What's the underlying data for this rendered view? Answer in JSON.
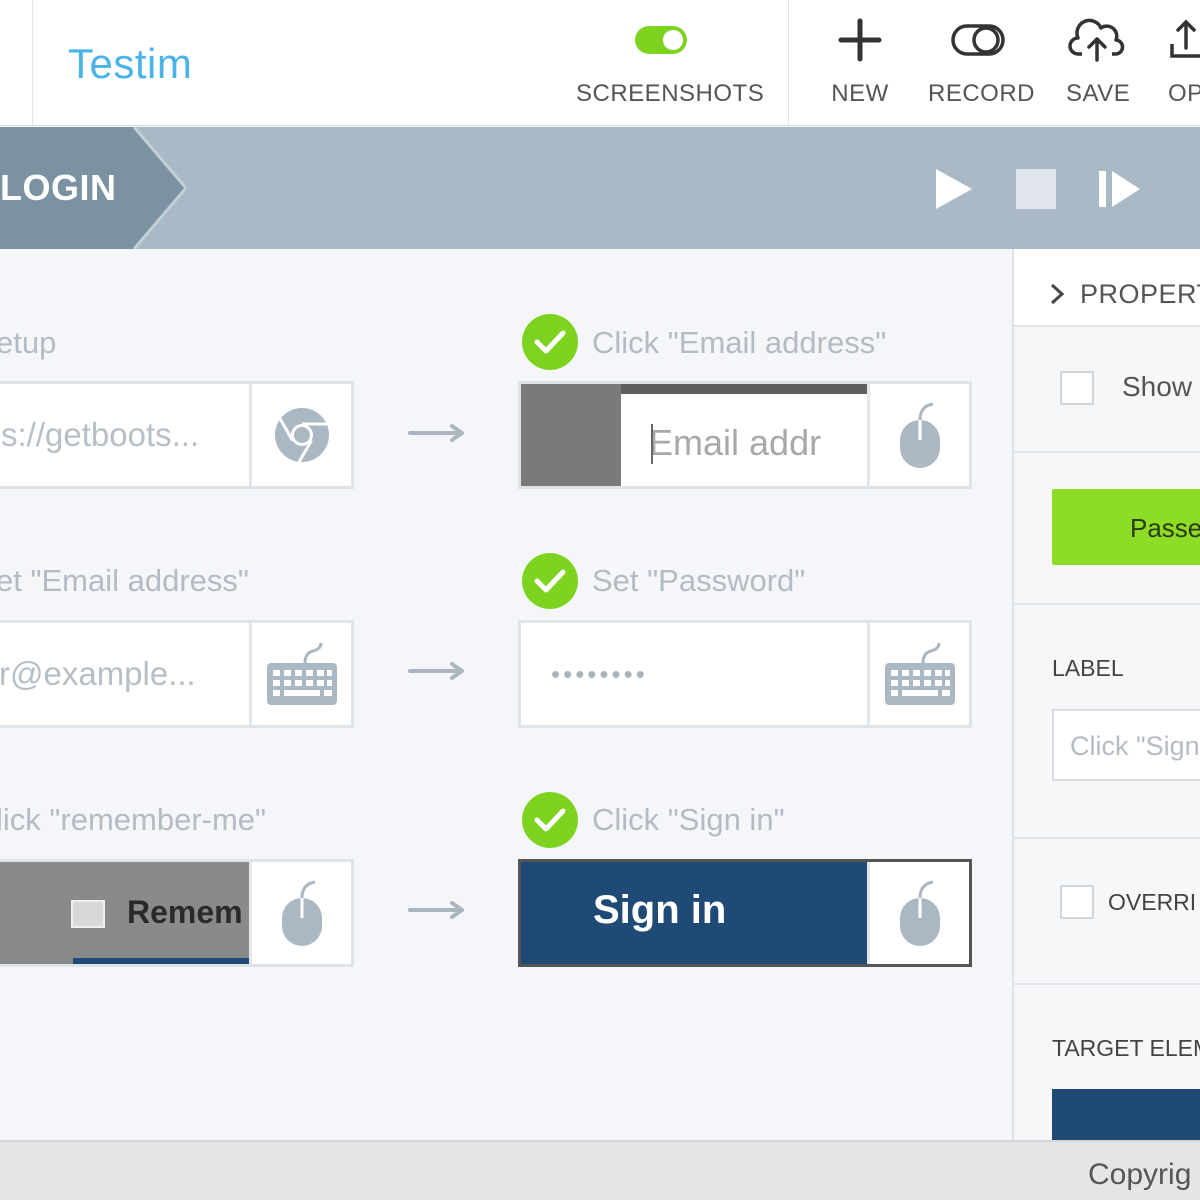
{
  "app": {
    "brand": "Testim"
  },
  "toolbar": {
    "screenshots_label": "SCREENSHOTS",
    "new_label": "NEW",
    "record_label": "RECORD",
    "save_label": "SAVE",
    "open_label": "OP"
  },
  "breadcrumb": {
    "test_name": "LOGIN"
  },
  "steps": [
    {
      "title": "etup",
      "thumb_text": "s://getboots...",
      "action_icon": "chrome-icon",
      "status": "none"
    },
    {
      "title": "Click \"Email address\"",
      "thumb_text": "Email addr",
      "action_icon": "mouse-icon",
      "status": "passed"
    },
    {
      "title": "et \"Email address\"",
      "thumb_text": "r@example...",
      "action_icon": "keyboard-icon",
      "status": "none"
    },
    {
      "title": "Set \"Password\"",
      "thumb_text": "••••••••",
      "action_icon": "keyboard-icon",
      "status": "passed"
    },
    {
      "title": "lick \"remember-me\"",
      "thumb_text": "Remem",
      "action_icon": "mouse-icon",
      "status": "none"
    },
    {
      "title": "Click \"Sign in\"",
      "thumb_text": "Sign in",
      "action_icon": "mouse-icon",
      "status": "passed"
    }
  ],
  "properties": {
    "header": "PROPERT",
    "show_label": "Show",
    "status_button": "Passe",
    "label_heading": "LABEL",
    "label_value": "Click \"Sign",
    "override_label": "OVERRI",
    "target_heading": "TARGET ELEM"
  },
  "footer": {
    "copyright": "Copyrig"
  },
  "colors": {
    "brand": "#4ab3e8",
    "success": "#7ed321",
    "crumb_bar": "#a9bac6",
    "crumb_active": "#7b92a3",
    "signin_blue": "#1f4a75"
  }
}
